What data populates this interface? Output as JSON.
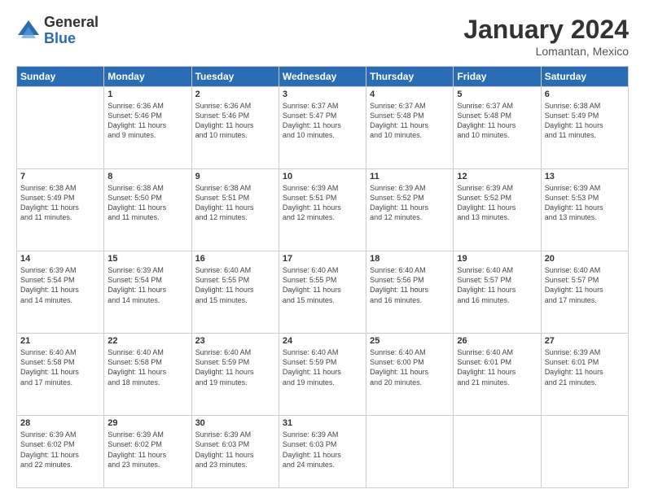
{
  "header": {
    "logo_general": "General",
    "logo_blue": "Blue",
    "month_title": "January 2024",
    "location": "Lomantan, Mexico"
  },
  "days_of_week": [
    "Sunday",
    "Monday",
    "Tuesday",
    "Wednesday",
    "Thursday",
    "Friday",
    "Saturday"
  ],
  "weeks": [
    [
      {
        "day": "",
        "info": ""
      },
      {
        "day": "1",
        "info": "Sunrise: 6:36 AM\nSunset: 5:46 PM\nDaylight: 11 hours\nand 9 minutes."
      },
      {
        "day": "2",
        "info": "Sunrise: 6:36 AM\nSunset: 5:46 PM\nDaylight: 11 hours\nand 10 minutes."
      },
      {
        "day": "3",
        "info": "Sunrise: 6:37 AM\nSunset: 5:47 PM\nDaylight: 11 hours\nand 10 minutes."
      },
      {
        "day": "4",
        "info": "Sunrise: 6:37 AM\nSunset: 5:48 PM\nDaylight: 11 hours\nand 10 minutes."
      },
      {
        "day": "5",
        "info": "Sunrise: 6:37 AM\nSunset: 5:48 PM\nDaylight: 11 hours\nand 10 minutes."
      },
      {
        "day": "6",
        "info": "Sunrise: 6:38 AM\nSunset: 5:49 PM\nDaylight: 11 hours\nand 11 minutes."
      }
    ],
    [
      {
        "day": "7",
        "info": "Sunrise: 6:38 AM\nSunset: 5:49 PM\nDaylight: 11 hours\nand 11 minutes."
      },
      {
        "day": "8",
        "info": "Sunrise: 6:38 AM\nSunset: 5:50 PM\nDaylight: 11 hours\nand 11 minutes."
      },
      {
        "day": "9",
        "info": "Sunrise: 6:38 AM\nSunset: 5:51 PM\nDaylight: 11 hours\nand 12 minutes."
      },
      {
        "day": "10",
        "info": "Sunrise: 6:39 AM\nSunset: 5:51 PM\nDaylight: 11 hours\nand 12 minutes."
      },
      {
        "day": "11",
        "info": "Sunrise: 6:39 AM\nSunset: 5:52 PM\nDaylight: 11 hours\nand 12 minutes."
      },
      {
        "day": "12",
        "info": "Sunrise: 6:39 AM\nSunset: 5:52 PM\nDaylight: 11 hours\nand 13 minutes."
      },
      {
        "day": "13",
        "info": "Sunrise: 6:39 AM\nSunset: 5:53 PM\nDaylight: 11 hours\nand 13 minutes."
      }
    ],
    [
      {
        "day": "14",
        "info": "Sunrise: 6:39 AM\nSunset: 5:54 PM\nDaylight: 11 hours\nand 14 minutes."
      },
      {
        "day": "15",
        "info": "Sunrise: 6:39 AM\nSunset: 5:54 PM\nDaylight: 11 hours\nand 14 minutes."
      },
      {
        "day": "16",
        "info": "Sunrise: 6:40 AM\nSunset: 5:55 PM\nDaylight: 11 hours\nand 15 minutes."
      },
      {
        "day": "17",
        "info": "Sunrise: 6:40 AM\nSunset: 5:55 PM\nDaylight: 11 hours\nand 15 minutes."
      },
      {
        "day": "18",
        "info": "Sunrise: 6:40 AM\nSunset: 5:56 PM\nDaylight: 11 hours\nand 16 minutes."
      },
      {
        "day": "19",
        "info": "Sunrise: 6:40 AM\nSunset: 5:57 PM\nDaylight: 11 hours\nand 16 minutes."
      },
      {
        "day": "20",
        "info": "Sunrise: 6:40 AM\nSunset: 5:57 PM\nDaylight: 11 hours\nand 17 minutes."
      }
    ],
    [
      {
        "day": "21",
        "info": "Sunrise: 6:40 AM\nSunset: 5:58 PM\nDaylight: 11 hours\nand 17 minutes."
      },
      {
        "day": "22",
        "info": "Sunrise: 6:40 AM\nSunset: 5:58 PM\nDaylight: 11 hours\nand 18 minutes."
      },
      {
        "day": "23",
        "info": "Sunrise: 6:40 AM\nSunset: 5:59 PM\nDaylight: 11 hours\nand 19 minutes."
      },
      {
        "day": "24",
        "info": "Sunrise: 6:40 AM\nSunset: 5:59 PM\nDaylight: 11 hours\nand 19 minutes."
      },
      {
        "day": "25",
        "info": "Sunrise: 6:40 AM\nSunset: 6:00 PM\nDaylight: 11 hours\nand 20 minutes."
      },
      {
        "day": "26",
        "info": "Sunrise: 6:40 AM\nSunset: 6:01 PM\nDaylight: 11 hours\nand 21 minutes."
      },
      {
        "day": "27",
        "info": "Sunrise: 6:39 AM\nSunset: 6:01 PM\nDaylight: 11 hours\nand 21 minutes."
      }
    ],
    [
      {
        "day": "28",
        "info": "Sunrise: 6:39 AM\nSunset: 6:02 PM\nDaylight: 11 hours\nand 22 minutes."
      },
      {
        "day": "29",
        "info": "Sunrise: 6:39 AM\nSunset: 6:02 PM\nDaylight: 11 hours\nand 23 minutes."
      },
      {
        "day": "30",
        "info": "Sunrise: 6:39 AM\nSunset: 6:03 PM\nDaylight: 11 hours\nand 23 minutes."
      },
      {
        "day": "31",
        "info": "Sunrise: 6:39 AM\nSunset: 6:03 PM\nDaylight: 11 hours\nand 24 minutes."
      },
      {
        "day": "",
        "info": ""
      },
      {
        "day": "",
        "info": ""
      },
      {
        "day": "",
        "info": ""
      }
    ]
  ]
}
